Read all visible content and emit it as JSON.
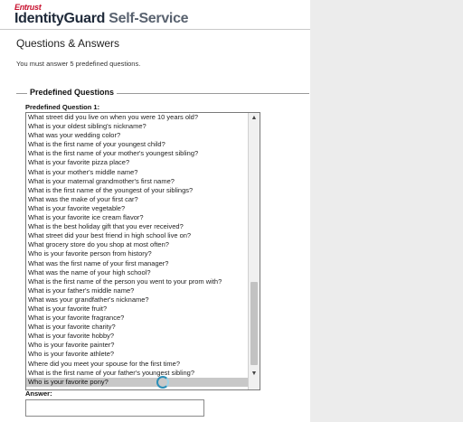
{
  "header": {
    "brand": "Entrust",
    "product_name": "IdentityGuard",
    "product_suffix": "Self-Service"
  },
  "main": {
    "title": "Questions & Answers",
    "instruction": "You must answer 5 predefined questions.",
    "section_legend": "Predefined Questions",
    "question_label": "Predefined Question 1:",
    "questions": [
      "What street did you live on when you were 10 years old?",
      "What is your oldest sibling's nickname?",
      "What was your wedding color?",
      "What is the first name of your youngest child?",
      "What is the first name of your mother's youngest sibling?",
      "What is your favorite pizza place?",
      "What is your mother's middle name?",
      "What is your maternal grandmother's first name?",
      "What is the first name of the youngest of your siblings?",
      "What was the make of your first car?",
      "What is your favorite vegetable?",
      "What is your favorite ice cream flavor?",
      "What is the best holiday gift that you ever received?",
      "What street did your best friend in high school live on?",
      "What grocery store do you shop at most often?",
      "Who is your favorite person from history?",
      "What was the first name of your first manager?",
      "What was the name of your high school?",
      "What is the first name of the person you went to your prom with?",
      "What is your father's middle name?",
      "What was your grandfather's nickname?",
      "What is your favorite fruit?",
      "What is your favorite fragrance?",
      "What is your favorite charity?",
      "What is your favorite hobby?",
      "Who is your favorite painter?",
      "Who is your favorite athlete?",
      "Where did you meet your spouse for the first time?",
      "What is the first name of your father's youngest sibling?",
      "Who is your favorite pony?"
    ],
    "selected_index": 29,
    "answer_label": "Answer:",
    "answer_value": ""
  }
}
